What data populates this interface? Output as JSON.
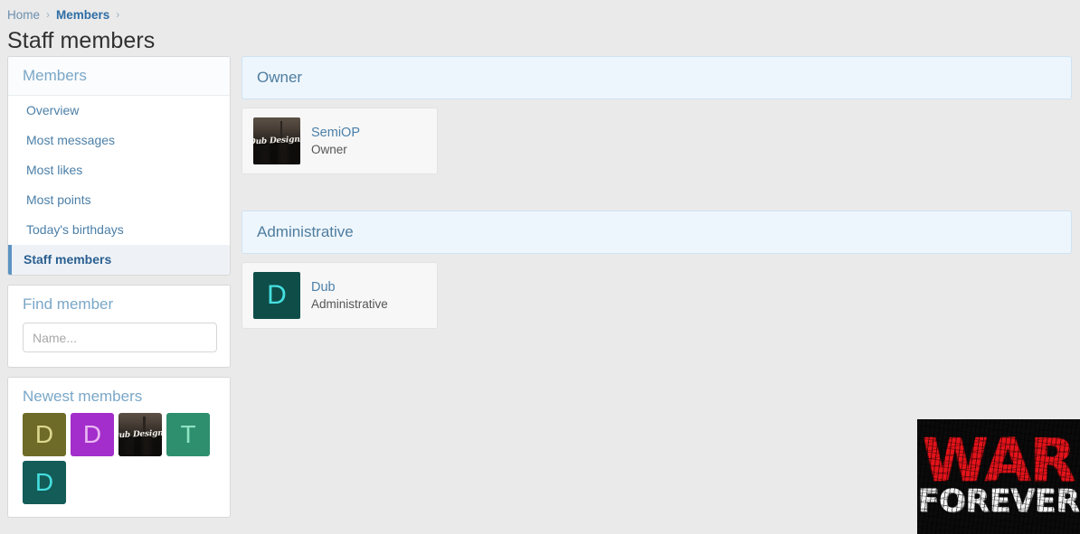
{
  "breadcrumb": {
    "home": "Home",
    "separator": "›",
    "members": "Members",
    "trailing_separator": "›"
  },
  "page": {
    "title": "Staff members",
    "background_color": "#eaeaea"
  },
  "sidebar": {
    "nav_block": {
      "header": "Members",
      "items": [
        {
          "label": "Overview",
          "active": false
        },
        {
          "label": "Most messages",
          "active": false
        },
        {
          "label": "Most likes",
          "active": false
        },
        {
          "label": "Most points",
          "active": false
        },
        {
          "label": "Today's birthdays",
          "active": false
        },
        {
          "label": "Staff members",
          "active": true
        }
      ],
      "active_accent_color": "#5d93c4"
    },
    "find_member": {
      "header": "Find member",
      "input_value": "",
      "input_placeholder": "Name..."
    },
    "newest_members": {
      "header": "Newest members",
      "avatars": [
        {
          "type": "letter",
          "letter": "D",
          "bg": "#6e6b28",
          "fg": "#dcd88f"
        },
        {
          "type": "letter",
          "letter": "D",
          "bg": "#a32ecb",
          "fg": "#eab8f2"
        },
        {
          "type": "photo",
          "caption": "Dub Designs"
        },
        {
          "type": "letter",
          "letter": "T",
          "bg": "#2e8f6e",
          "fg": "#8ee3c2"
        },
        {
          "type": "letter",
          "letter": "D",
          "bg": "#135c57",
          "fg": "#45dfe0"
        }
      ]
    }
  },
  "main": {
    "sections": [
      {
        "header": "Owner",
        "members": [
          {
            "name": "SemiOP",
            "title": "Owner",
            "avatar": {
              "type": "photo",
              "caption": "Dub Designs"
            }
          }
        ]
      },
      {
        "header": "Administrative",
        "members": [
          {
            "name": "Dub",
            "title": "Administrative",
            "avatar": {
              "type": "letter",
              "letter": "D",
              "bg": "#0f4d49",
              "fg": "#45dfe0"
            }
          }
        ]
      }
    ]
  },
  "banner": {
    "line1": "WAR",
    "line2": "FOREVER",
    "line1_color": "#e4131a",
    "line2_color": "#f4f4f4",
    "background_color": "#0b0b0b"
  }
}
